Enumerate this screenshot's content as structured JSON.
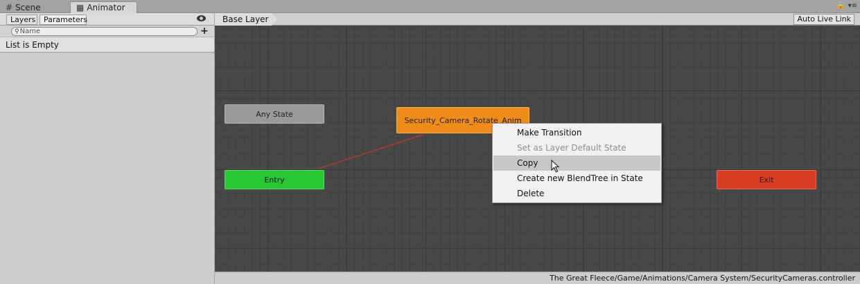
{
  "tabs": [
    {
      "label": "Scene",
      "icon": "grid-icon"
    },
    {
      "label": "Animator",
      "icon": "animator-icon",
      "active": true
    }
  ],
  "left_panel": {
    "layers_label": "Layers",
    "parameters_label": "Parameters",
    "search_placeholder": "Name",
    "empty_text": "List is Empty"
  },
  "graph": {
    "breadcrumb": "Base Layer",
    "auto_live_link": "Auto Live Link",
    "nodes": {
      "any_state": "Any State",
      "entry": "Entry",
      "state": "Security_Camera_Rotate_Anim",
      "exit": "Exit"
    }
  },
  "context_menu": {
    "items": [
      {
        "label": "Make Transition",
        "enabled": true
      },
      {
        "label": "Set as Layer Default State",
        "enabled": false
      },
      {
        "label": "Copy",
        "enabled": true,
        "hovered": true
      },
      {
        "label": "Create new BlendTree in State",
        "enabled": true
      },
      {
        "label": "Delete",
        "enabled": true
      }
    ]
  },
  "status": {
    "path": "The Great Fleece/Game/Animations/Camera System/SecurityCameras.controller"
  },
  "colors": {
    "entry": "#29c633",
    "state": "#f08c1a",
    "exit": "#d83c22",
    "any_state": "#9a9a9a",
    "transition": "#c0392b"
  }
}
